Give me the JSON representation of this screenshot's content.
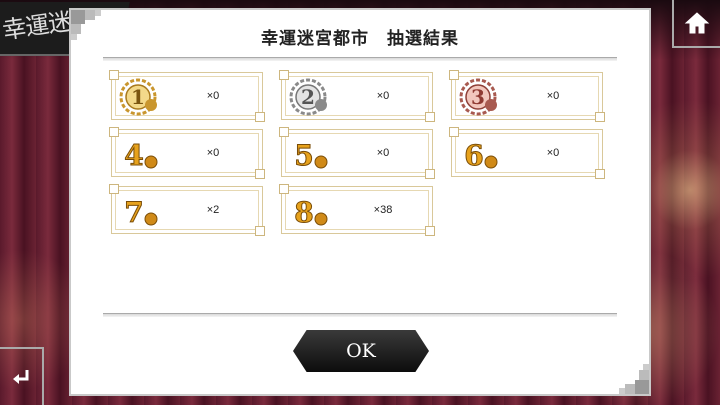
{
  "background": {
    "banner_text": "幸運迷"
  },
  "dialog": {
    "title": "幸運迷宮都市　抽選結果",
    "results": [
      {
        "rank": "1",
        "medal": "gold-laurel",
        "count": "×0"
      },
      {
        "rank": "2",
        "medal": "silver-laurel",
        "count": "×0"
      },
      {
        "rank": "3",
        "medal": "bronze-laurel",
        "count": "×0"
      },
      {
        "rank": "4",
        "medal": "gold-text",
        "count": "×0"
      },
      {
        "rank": "5",
        "medal": "gold-text",
        "count": "×0"
      },
      {
        "rank": "6",
        "medal": "gold-text",
        "count": "×0"
      },
      {
        "rank": "7",
        "medal": "gold-text",
        "count": "×2"
      },
      {
        "rank": "8",
        "medal": "gold-text",
        "count": "×38"
      }
    ],
    "ok_label": "OK"
  },
  "icons": {
    "home": "home-icon",
    "back": "back-arrow-icon"
  },
  "colors": {
    "gold": "#c9962e",
    "silver": "#9a9a9a",
    "bronze": "#b0605a",
    "dialog_bg": "#ffffff",
    "button_bg": "#111111"
  }
}
